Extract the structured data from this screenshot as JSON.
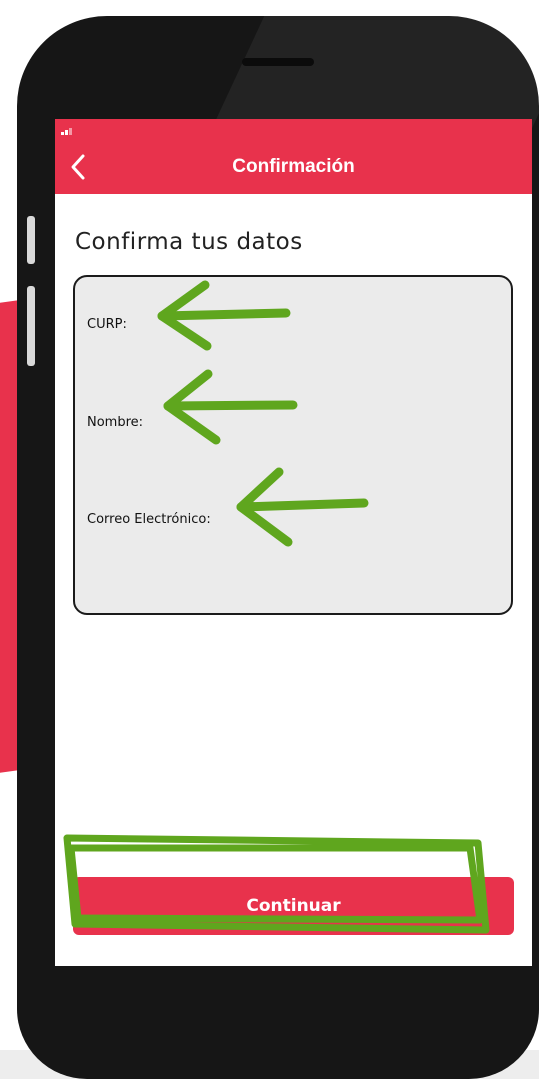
{
  "header": {
    "title": "Confirmación",
    "back_icon": "chevron-left-icon"
  },
  "main": {
    "section_title": "Confirma tus datos",
    "fields": [
      {
        "label": "CURP:",
        "value": ""
      },
      {
        "label": "Nombre:",
        "value": ""
      },
      {
        "label": "Correo Electrónico:",
        "value": ""
      }
    ]
  },
  "footer": {
    "continue_label": "Continuar"
  },
  "colors": {
    "brand_red": "#e8324c",
    "card_background": "#ebebeb",
    "annotation_green": "#5fa61e",
    "phone_body": "#161616"
  }
}
